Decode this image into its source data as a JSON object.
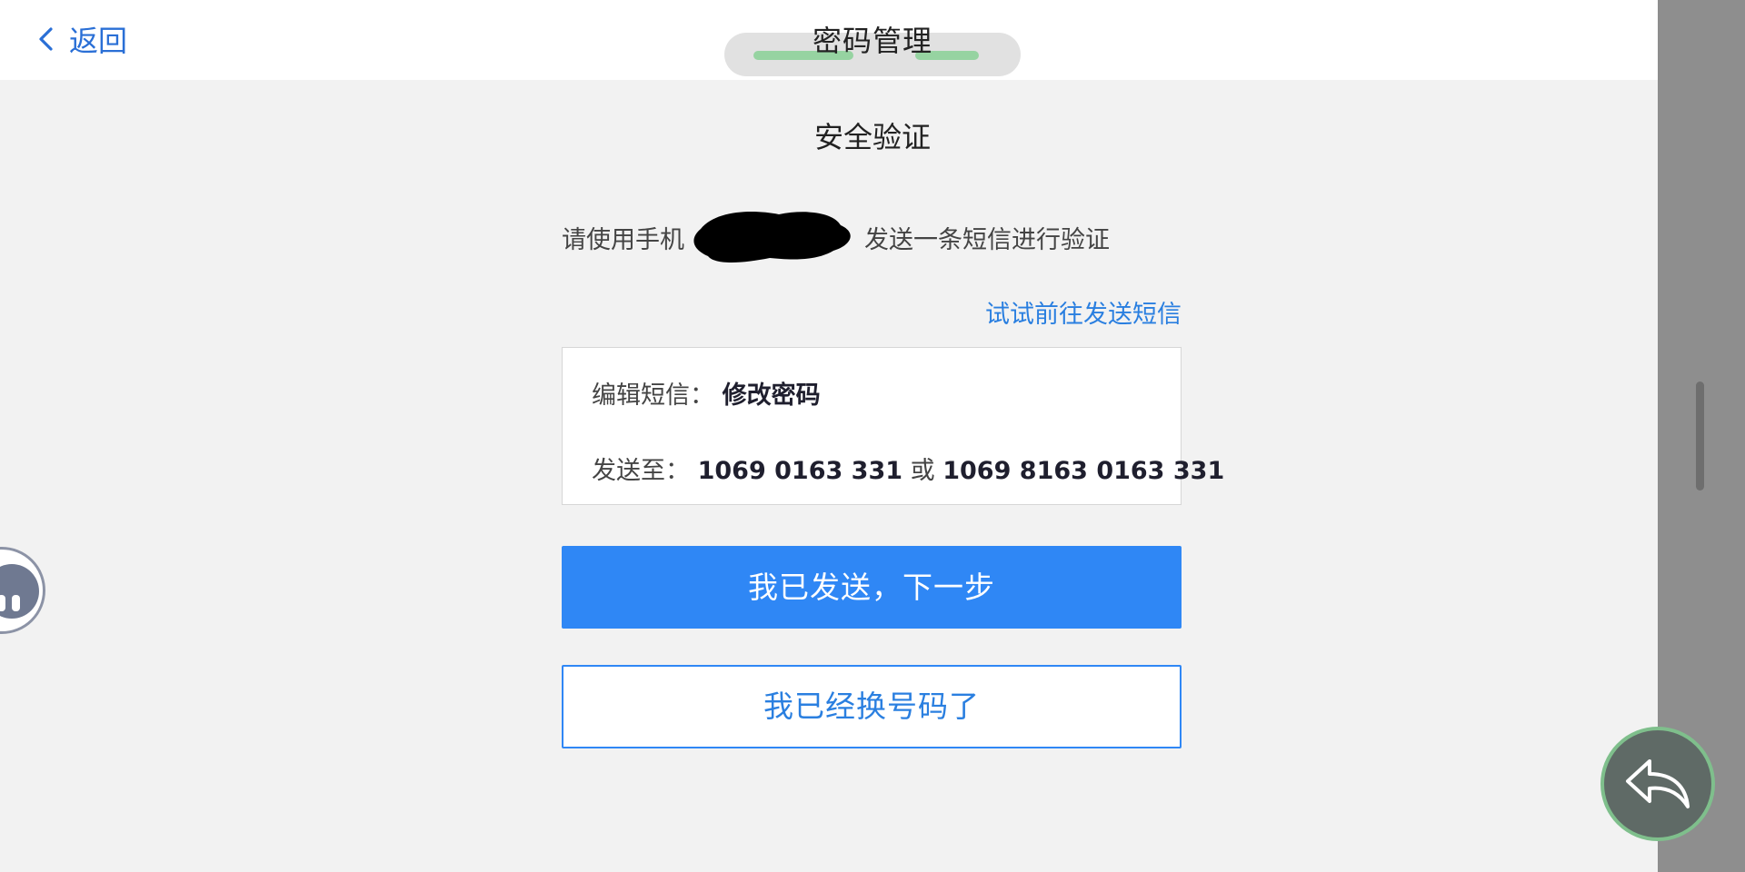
{
  "navbar": {
    "back_label": "返回",
    "title": "密码管理"
  },
  "content": {
    "section_title": "安全验证",
    "instruction_prefix": "请使用手机",
    "instruction_suffix": "发送一条短信进行验证",
    "try_link": "试试前往发送短信"
  },
  "sms_card": {
    "message_label": "编辑短信：",
    "message_value": "修改密码",
    "send_to_label": "发送至：",
    "number_1": "1069 0163 331",
    "or_text": "或",
    "number_2": "1069 8163 0163 331"
  },
  "actions": {
    "primary_label": "我已发送，下一步",
    "secondary_label": "我已经换号码了"
  },
  "icons": {
    "back": "chevron-left-icon",
    "assistant": "assistant-icon",
    "gesture_back": "reply-arrow-icon"
  },
  "colors": {
    "accent": "#2f87f5",
    "link": "#2a7fe0",
    "background": "#f2f2f2",
    "side_panel": "#8e8e8e"
  }
}
